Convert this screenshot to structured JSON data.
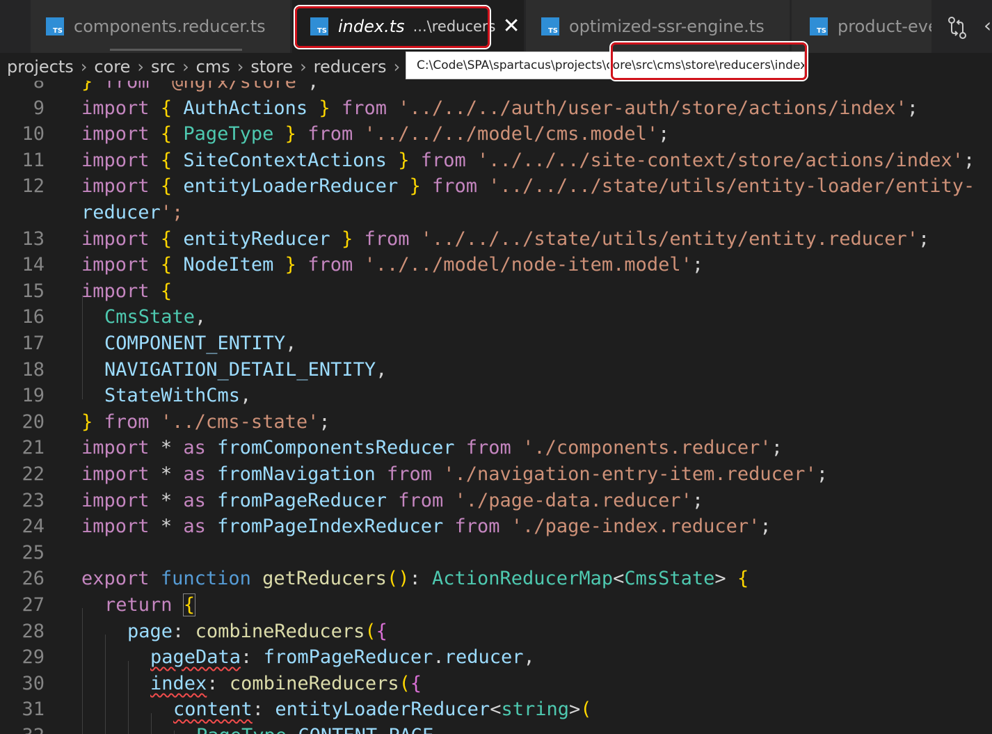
{
  "tabs": [
    {
      "label": "components.reducer.ts",
      "icon": "typescript-file-icon"
    },
    {
      "label": "index.ts",
      "description": "...\\reducers",
      "icon": "typescript-file-icon",
      "active": true
    },
    {
      "label": "optimized-ssr-engine.ts",
      "icon": "typescript-file-icon"
    },
    {
      "label": "product-eve",
      "icon": "typescript-file-icon"
    }
  ],
  "close_glyph": "✕",
  "more_glyph": "‹",
  "breadcrumbs": [
    "projects",
    "core",
    "src",
    "cms",
    "store",
    "reducers"
  ],
  "breadcrumb_sep": "›",
  "tooltip": {
    "prefix": "C:\\Code\\SPA\\spartacus\\projects\\co",
    "highlighted": "re\\src\\cms\\store\\reducers\\index.ts"
  },
  "colors": {
    "highlight": "#d0121b",
    "ts_icon": "#2f8ed6",
    "keyword": "#c586c0",
    "string": "#ce9178"
  },
  "code_lines": [
    {
      "n": "8",
      "text": "} from '@ngrx/store';"
    },
    {
      "n": "9",
      "text": "import { AuthActions } from '../../../auth/user-auth/store/actions/index';"
    },
    {
      "n": "10",
      "text": "import { PageType } from '../../../model/cms.model';"
    },
    {
      "n": "11",
      "text": "import { SiteContextActions } from '../../../site-context/store/actions/index';"
    },
    {
      "n": "12",
      "text": "import { entityLoaderReducer } from '../../../state/utils/entity-loader/entity-"
    },
    {
      "n": "",
      "text": "reducer';"
    },
    {
      "n": "13",
      "text": "import { entityReducer } from '../../../state/utils/entity/entity.reducer';"
    },
    {
      "n": "14",
      "text": "import { NodeItem } from '../../model/node-item.model';"
    },
    {
      "n": "15",
      "text": "import {"
    },
    {
      "n": "16",
      "text": "CmsState,"
    },
    {
      "n": "17",
      "text": "COMPONENT_ENTITY,"
    },
    {
      "n": "18",
      "text": "NAVIGATION_DETAIL_ENTITY,"
    },
    {
      "n": "19",
      "text": "StateWithCms,"
    },
    {
      "n": "20",
      "text": "} from '../cms-state';"
    },
    {
      "n": "21",
      "text": "import * as fromComponentsReducer from './components.reducer';"
    },
    {
      "n": "22",
      "text": "import * as fromNavigation from './navigation-entry-item.reducer';"
    },
    {
      "n": "23",
      "text": "import * as fromPageReducer from './page-data.reducer';"
    },
    {
      "n": "24",
      "text": "import * as fromPageIndexReducer from './page-index.reducer';"
    },
    {
      "n": "25",
      "text": ""
    },
    {
      "n": "26",
      "text": "export function getReducers(): ActionReducerMap<CmsState> {"
    },
    {
      "n": "27",
      "text": "return {"
    },
    {
      "n": "28",
      "text": "page: combineReducers({"
    },
    {
      "n": "29",
      "text": "pageData: fromPageReducer.reducer,"
    },
    {
      "n": "30",
      "text": "index: combineReducers({"
    },
    {
      "n": "31",
      "text": "content: entityLoaderReducer<string>("
    },
    {
      "n": "32",
      "text": "PageType.CONTENT_PAGE,"
    }
  ]
}
